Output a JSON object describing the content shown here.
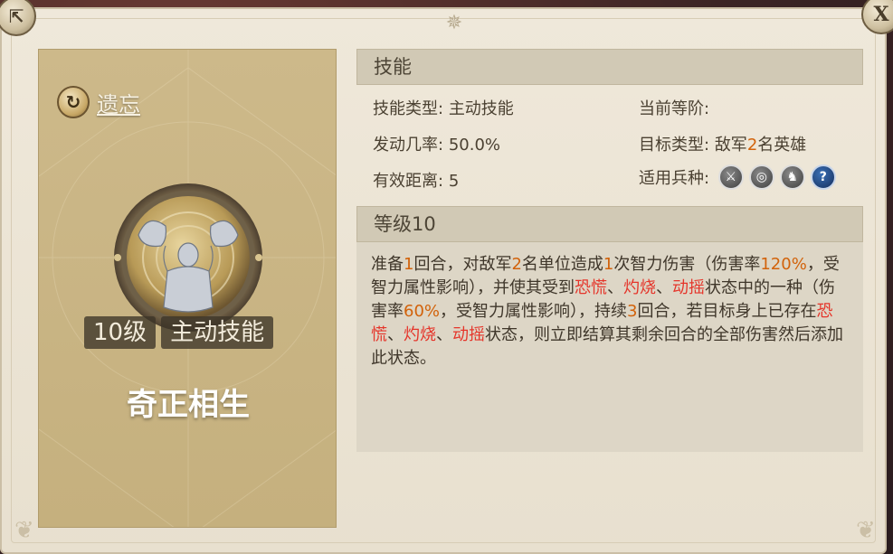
{
  "window": {
    "share_icon": "share-icon",
    "close_icon": "close-icon",
    "close_label": "X"
  },
  "left_card": {
    "forget_label": "遗忘",
    "forget_icon": "refresh-icon",
    "level_badge": "10级",
    "type_badge": "主动技能",
    "skill_name": "奇正相生",
    "skill_icon": "praying-figure-icon"
  },
  "skill_section": {
    "header": "技能",
    "type_label": "技能类型:",
    "type_value": "主动技能",
    "rate_label": "发动几率:",
    "rate_value": "50.0%",
    "range_label": "有效距离:",
    "range_value": "5",
    "rank_label": "当前等阶:",
    "rank_value": "",
    "target_label": "目标类型:",
    "target_prefix": "敌军",
    "target_count": "2",
    "target_suffix": "名英雄",
    "troop_label": "适用兵种:",
    "troop_icons": [
      "sword-icon",
      "bow-target-icon",
      "horse-icon",
      "question-icon"
    ]
  },
  "level_section": {
    "header": "等级10",
    "description": {
      "p1": "准备",
      "n1": "1",
      "p2": "回合，对敌军",
      "n2": "2",
      "p3": "名单位造成",
      "n3": "1",
      "p4": "次智力伤害（伤害率",
      "n4": "120%",
      "p5": "，受智力属性影响），并使其受到",
      "r1": "恐慌",
      "p6": "、",
      "r2": "灼烧",
      "p7": "、",
      "r3": "动摇",
      "p8": "状态中的一种（伤害率",
      "n5": "60%",
      "p9": "，受智力属性影响），持续",
      "n6": "3",
      "p10": "回合，若目标身上已存在",
      "r4": "恐慌",
      "p11": "、",
      "r5": "灼烧",
      "p12": "、",
      "r6": "动摇",
      "p13": "状态，则立即结算其剩余回合的全部伤害然后添加此状态。"
    }
  },
  "colors": {
    "highlight_number": "#d2620a",
    "highlight_status": "#e5352a",
    "card_bg": "#c9b483"
  }
}
